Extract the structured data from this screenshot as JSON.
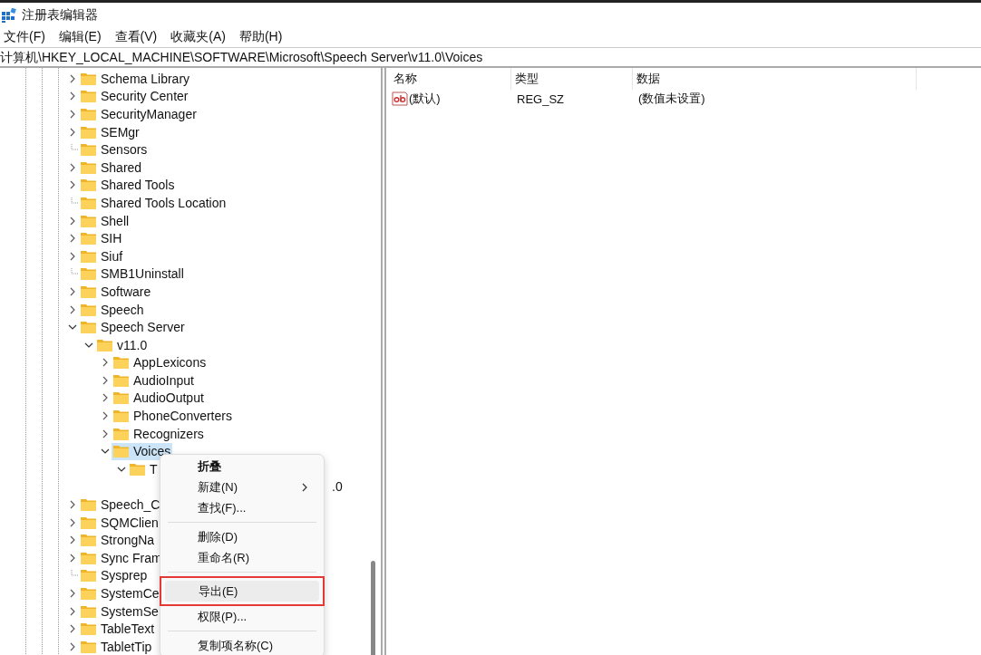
{
  "window": {
    "title": "注册表编辑器"
  },
  "menu_bar": [
    "文件(F)",
    "编辑(E)",
    "查看(V)",
    "收藏夹(A)",
    "帮助(H)"
  ],
  "address_bar": {
    "value": "计算机\\HKEY_LOCAL_MACHINE\\SOFTWARE\\Microsoft\\Speech Server\\v11.0\\Voices"
  },
  "tree": [
    {
      "label": "Schema Library",
      "kind": "collapsed",
      "selected": false
    },
    {
      "label": "Security Center",
      "kind": "collapsed",
      "selected": false
    },
    {
      "label": "SecurityManager",
      "kind": "collapsed",
      "selected": false
    },
    {
      "label": "SEMgr",
      "kind": "collapsed",
      "selected": false
    },
    {
      "label": "Sensors",
      "kind": "leaf",
      "selected": false
    },
    {
      "label": "Shared",
      "kind": "collapsed",
      "selected": false
    },
    {
      "label": "Shared Tools",
      "kind": "collapsed",
      "selected": false
    },
    {
      "label": "Shared Tools Location",
      "kind": "leaf",
      "selected": false
    },
    {
      "label": "Shell",
      "kind": "collapsed",
      "selected": false
    },
    {
      "label": "SIH",
      "kind": "collapsed",
      "selected": false
    },
    {
      "label": "Siuf",
      "kind": "collapsed",
      "selected": false
    },
    {
      "label": "SMB1Uninstall",
      "kind": "leaf",
      "selected": false
    },
    {
      "label": "Software",
      "kind": "collapsed",
      "selected": false
    },
    {
      "label": "Speech",
      "kind": "collapsed",
      "selected": false
    },
    {
      "label": "Speech Server",
      "kind": "expanded",
      "selected": false,
      "children": [
        {
          "label": "v11.0",
          "kind": "expanded",
          "selected": false,
          "children": [
            {
              "label": "AppLexicons",
              "kind": "collapsed",
              "selected": false
            },
            {
              "label": "AudioInput",
              "kind": "collapsed",
              "selected": false
            },
            {
              "label": "AudioOutput",
              "kind": "collapsed",
              "selected": false
            },
            {
              "label": "PhoneConverters",
              "kind": "collapsed",
              "selected": false
            },
            {
              "label": "Recognizers",
              "kind": "collapsed",
              "selected": false
            },
            {
              "label": "Voices",
              "kind": "expanded",
              "selected": true,
              "children": [
                {
                  "label": "T",
                  "kind": "expanded",
                  "selected": false,
                  "children": [
                    {
                      "label": ".0",
                      "kind": "covered",
                      "selected": false
                    }
                  ]
                }
              ]
            }
          ]
        }
      ]
    },
    {
      "label": "Speech_C",
      "kind": "collapsed",
      "selected": false
    },
    {
      "label": "SQMClien",
      "kind": "collapsed",
      "selected": false
    },
    {
      "label": "StrongNa",
      "kind": "collapsed",
      "selected": false
    },
    {
      "label": "Sync Fram",
      "kind": "collapsed",
      "selected": false
    },
    {
      "label": "Sysprep",
      "kind": "leaf",
      "selected": false
    },
    {
      "label": "SystemCe",
      "kind": "collapsed",
      "selected": false
    },
    {
      "label": "SystemSe",
      "kind": "collapsed",
      "selected": false
    },
    {
      "label": "TableText",
      "kind": "collapsed",
      "selected": false
    },
    {
      "label": "TabletTip",
      "kind": "collapsed",
      "selected": false
    }
  ],
  "values_table": {
    "columns": [
      "名称",
      "类型",
      "数据"
    ],
    "rows": [
      {
        "name": "(默认)",
        "type": "REG_SZ",
        "data": "(数值未设置)"
      }
    ]
  },
  "context_menu": [
    {
      "label": "折叠",
      "kind": "default",
      "selected": false,
      "highlighted": false
    },
    {
      "label": "新建(N)",
      "kind": "submenu",
      "selected": false,
      "highlighted": false
    },
    {
      "label": "查找(F)...",
      "kind": "item",
      "selected": false,
      "highlighted": false
    },
    {
      "kind": "separator"
    },
    {
      "label": "删除(D)",
      "kind": "item",
      "selected": false,
      "highlighted": false
    },
    {
      "label": "重命名(R)",
      "kind": "item",
      "selected": false,
      "highlighted": false
    },
    {
      "kind": "separator"
    },
    {
      "label": "导出(E)",
      "kind": "item",
      "selected": true,
      "highlighted": true
    },
    {
      "label": "权限(P)...",
      "kind": "item",
      "selected": false,
      "highlighted": false
    },
    {
      "kind": "separator"
    },
    {
      "label": "复制项名称(C)",
      "kind": "item",
      "selected": false,
      "highlighted": false
    }
  ]
}
